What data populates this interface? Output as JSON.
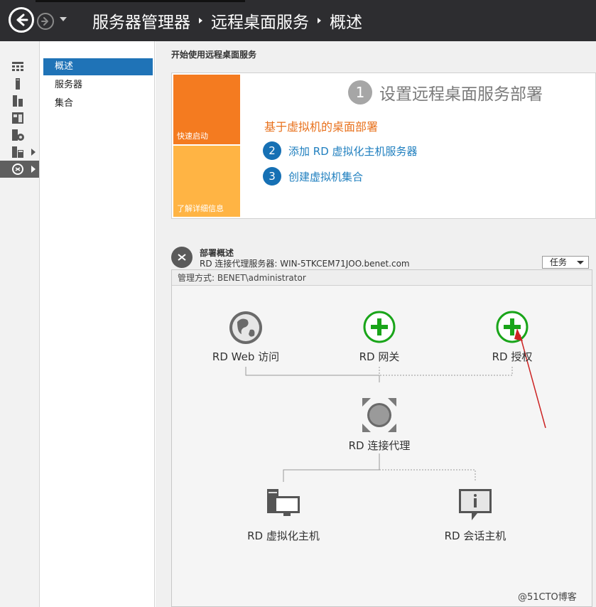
{
  "title_bar": {
    "breadcrumbs": [
      "服务器管理器",
      "远程桌面服务",
      "概述"
    ],
    "back_icon": "back-arrow-icon",
    "forward_icon": "forward-arrow-icon",
    "history_icon": "dropdown-caret-icon"
  },
  "icon_strip": {
    "items": [
      {
        "icon": "dashboard-icon"
      },
      {
        "icon": "local-server-icon"
      },
      {
        "icon": "all-servers-icon"
      },
      {
        "icon": "file-storage-icon"
      },
      {
        "icon": "iis-icon"
      },
      {
        "icon": "file-services-icon",
        "expandable": true
      },
      {
        "icon": "remote-desktop-icon",
        "expandable": true,
        "active": true
      }
    ]
  },
  "nav_pane": {
    "items": [
      {
        "label": "概述",
        "active": true
      },
      {
        "label": "服务器"
      },
      {
        "label": "集合"
      }
    ]
  },
  "main": {
    "section_title": "开始使用远程桌面服务",
    "quick_start": {
      "tile_quick": "快速启动",
      "tile_learn": "了解详细信息",
      "step1_number": "1",
      "step1_label": "设置远程桌面服务部署",
      "subheading": "基于虚拟机的桌面部署",
      "step2_number": "2",
      "step2_label": "添加 RD 虚拟化主机服务器",
      "step3_number": "3",
      "step3_label": "创建虚拟机集合"
    },
    "deployment": {
      "title": "部署概述",
      "broker_line": "RD 连接代理服务器: WIN-5TKCEM71JOO.benet.com",
      "tasks_label": "任务",
      "managed_by": "管理方式: BENET\\administrator",
      "nodes": {
        "web_access": "RD Web 访问",
        "gateway": "RD 网关",
        "licensing": "RD 授权",
        "broker": "RD 连接代理",
        "virtualization_host": "RD 虚拟化主机",
        "session_host": "RD 会话主机"
      }
    }
  },
  "watermark": "@51CTO博客",
  "colors": {
    "title_bar": "#2d2d30",
    "nav_active": "#1f73b7",
    "tile_quick": "#f47b20",
    "tile_learn": "#ffb444",
    "subheading": "#e8711c",
    "step_circle": "#1670b4",
    "add_role_green": "#1aa51a",
    "annotation_arrow": "#cc2222"
  }
}
